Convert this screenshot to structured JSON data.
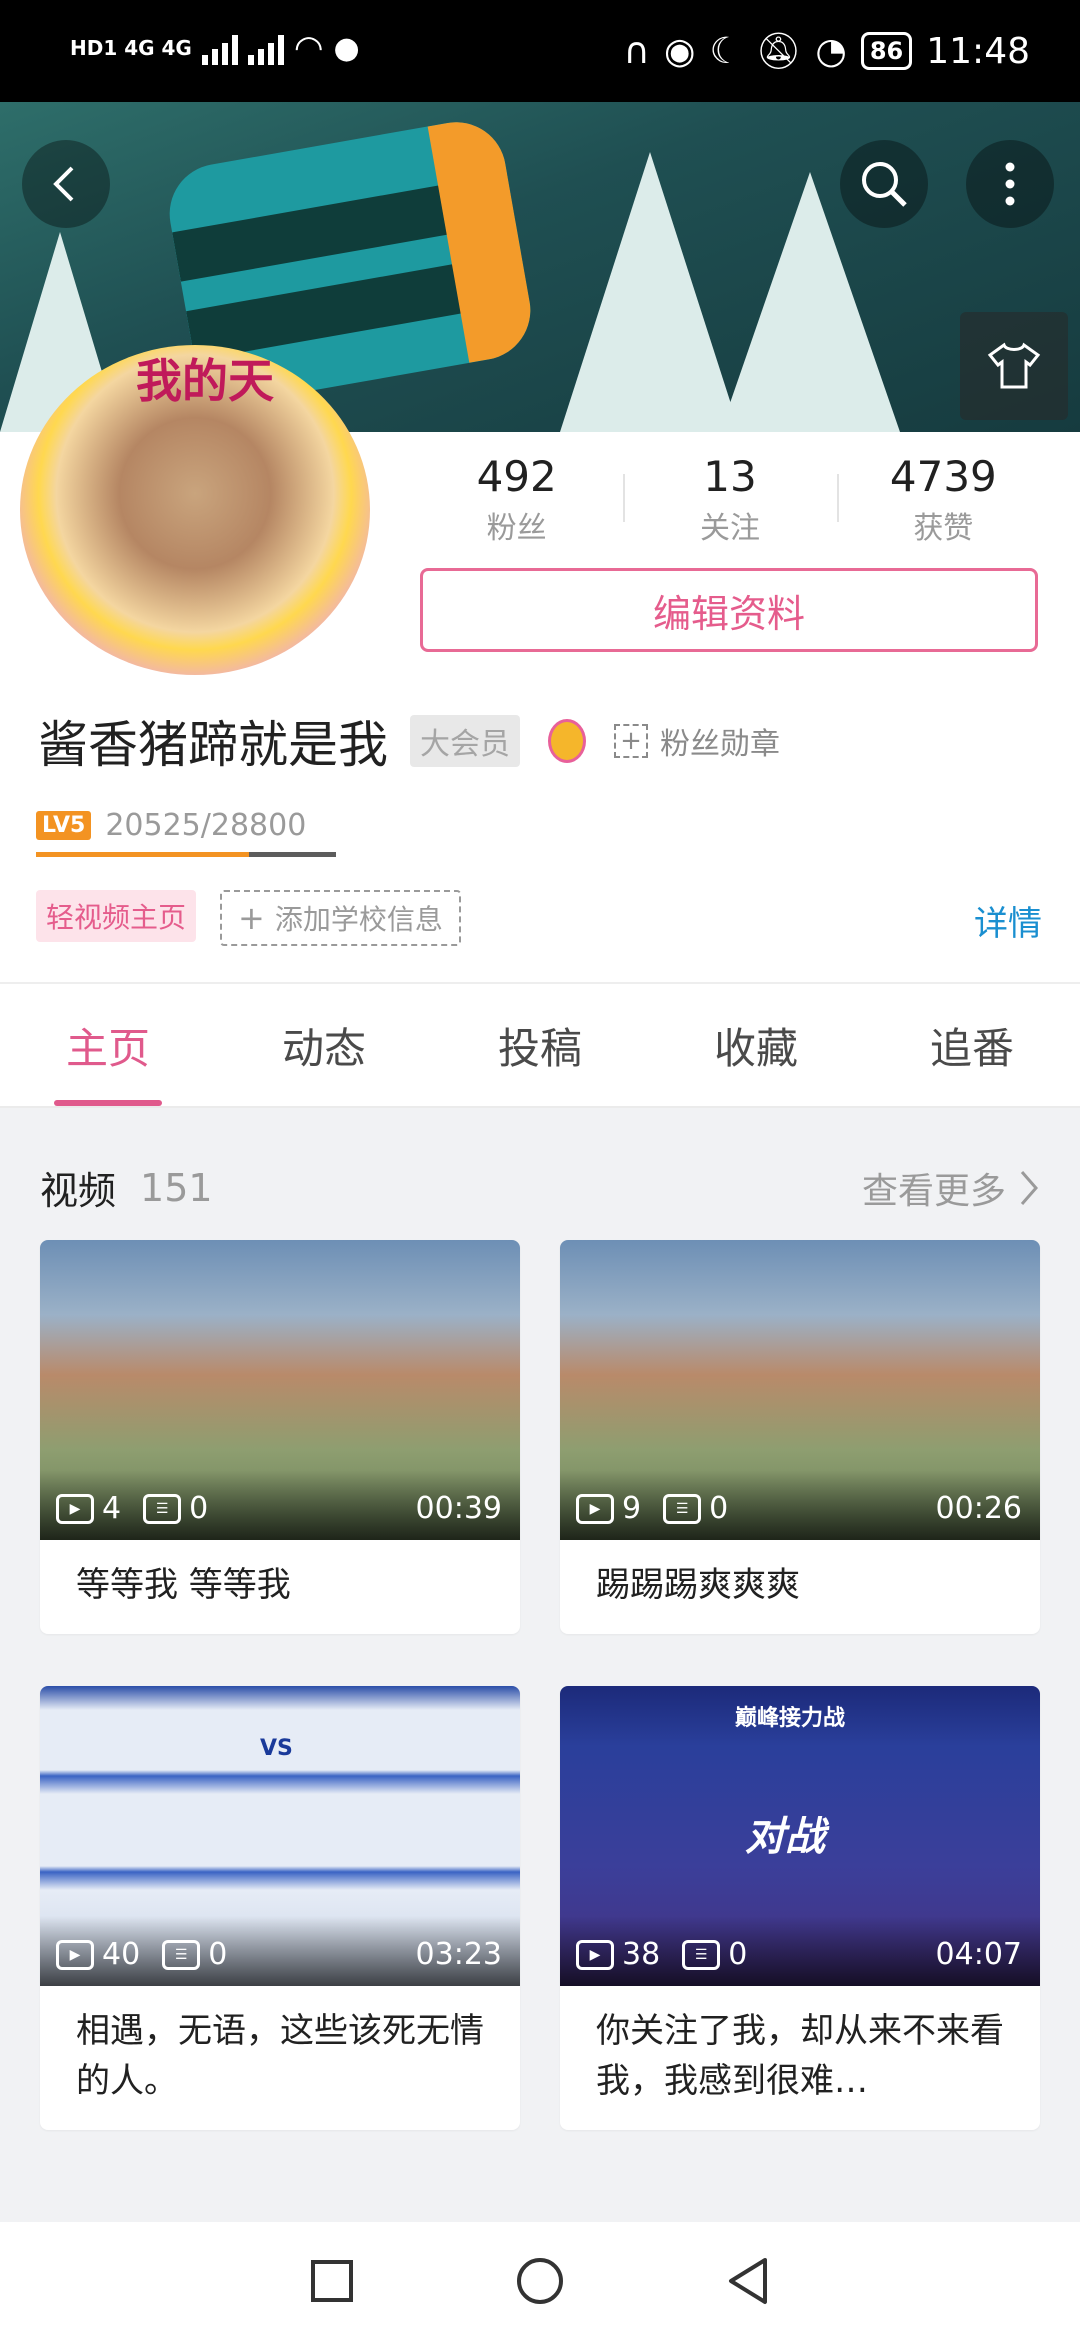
{
  "status_bar": {
    "network_left": "HD1 4G 4G",
    "battery": "86",
    "time": "11:48"
  },
  "header": {
    "back_icon": "back-arrow-icon",
    "search_icon": "search-icon",
    "more_icon": "more-vertical-icon",
    "dress_icon": "tshirt-icon",
    "avatar_caption": "我的天"
  },
  "stats": [
    {
      "value": "492",
      "label": "粉丝"
    },
    {
      "value": "13",
      "label": "关注"
    },
    {
      "value": "4739",
      "label": "获赞"
    }
  ],
  "profile": {
    "edit_label": "编辑资料",
    "username": "酱香猪蹄就是我",
    "vip_badge": "大会员",
    "fan_medal_label": "粉丝勋章",
    "level_badge": "LV5",
    "experience": "20525/28800",
    "experience_progress": 0.71,
    "light_video_label": "轻视频主页",
    "add_school_label": "添加学校信息",
    "details_label": "详情"
  },
  "tabs": [
    {
      "label": "主页",
      "active": true
    },
    {
      "label": "动态",
      "active": false
    },
    {
      "label": "投稿",
      "active": false
    },
    {
      "label": "收藏",
      "active": false
    },
    {
      "label": "追番",
      "active": false
    }
  ],
  "videos_section": {
    "title": "视频",
    "count": "151",
    "more_label": "查看更多"
  },
  "videos": [
    {
      "plays": "4",
      "comments": "0",
      "duration": "00:39",
      "title": "等等我 等等我"
    },
    {
      "plays": "9",
      "comments": "0",
      "duration": "00:26",
      "title": "踢踢踢爽爽爽"
    },
    {
      "plays": "40",
      "comments": "0",
      "duration": "03:23",
      "title": "相遇，无语，这些该死无情的人。"
    },
    {
      "plays": "38",
      "comments": "0",
      "duration": "04:07",
      "title": "你关注了我，却从来不来看我，我感到很难…"
    }
  ],
  "thumb_texts": {
    "v4_center": "对战",
    "v4_top": "巅峰接力战",
    "v3_vs": "VS"
  },
  "colors": {
    "accent_pink": "#e05a8c",
    "link_blue": "#1a8fd0",
    "level_orange": "#f39322"
  }
}
